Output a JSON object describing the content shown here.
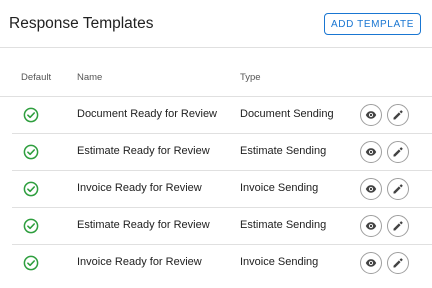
{
  "header": {
    "title": "Response Templates",
    "add_label": "ADD TEMPLATE"
  },
  "table": {
    "columns": [
      "Default",
      "Name",
      "Type"
    ],
    "rows": [
      {
        "name": "Document Ready for Review",
        "type": "Document Sending",
        "default": true
      },
      {
        "name": "Estimate Ready for Review",
        "type": "Estimate Sending",
        "default": true
      },
      {
        "name": "Invoice Ready for Review",
        "type": "Invoice Sending",
        "default": true
      },
      {
        "name": "Estimate Ready for Review",
        "type": "Estimate Sending",
        "default": true
      },
      {
        "name": "Invoice Ready for Review",
        "type": "Invoice Sending",
        "default": true
      }
    ]
  },
  "icons": {
    "default": "check-circle-icon",
    "view": "eye-icon",
    "edit": "pencil-icon"
  },
  "colors": {
    "accent": "#1976d2",
    "check": "#2e9e3e",
    "icon": "#424242"
  }
}
